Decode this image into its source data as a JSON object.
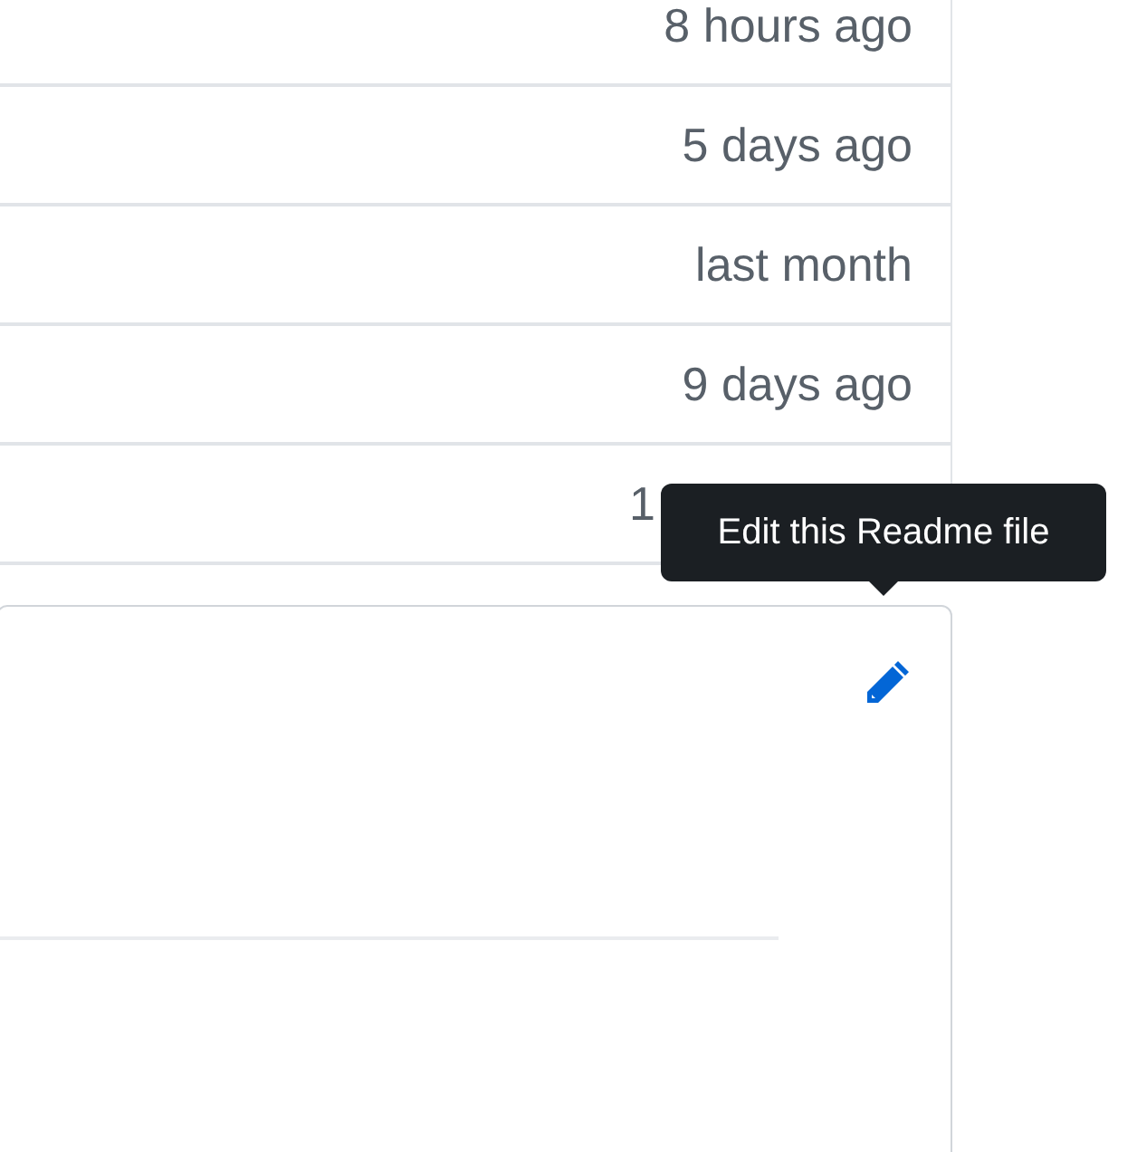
{
  "file_list": {
    "rows": [
      {
        "age": "8 hours ago"
      },
      {
        "age": "5 days ago"
      },
      {
        "age": "last month"
      },
      {
        "age": "9 days ago"
      },
      {
        "age": "1",
        "cut_by_tooltip": true
      }
    ]
  },
  "readme": {
    "edit_tooltip": "Edit this Readme file"
  }
}
